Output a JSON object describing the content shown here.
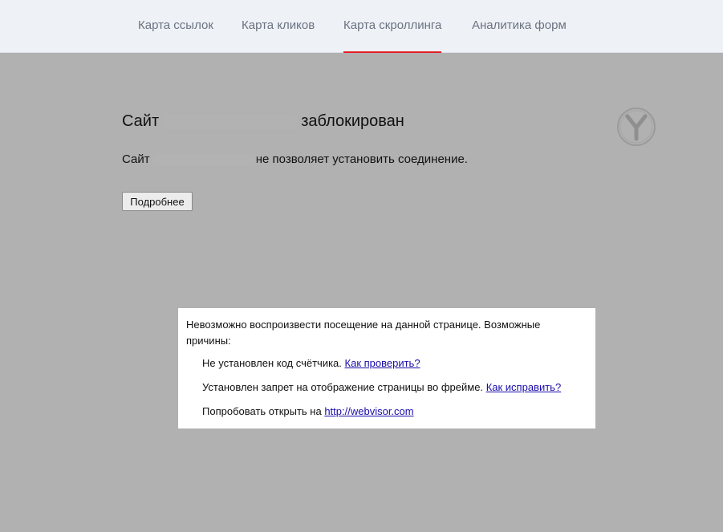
{
  "tabs": [
    {
      "label": "Карта ссылок",
      "active": false
    },
    {
      "label": "Карта кликов",
      "active": false
    },
    {
      "label": "Карта скроллинга",
      "active": true
    },
    {
      "label": "Аналитика форм",
      "active": false
    }
  ],
  "colors": {
    "active_tab_underline": "#e31e24",
    "page_background": "#b1b1b1",
    "nav_background": "#eef2f7"
  },
  "blocked_page": {
    "title_prefix": "Сайт",
    "title_suffix": "заблокирован",
    "desc_prefix": "Сайт",
    "desc_suffix": "не позволяет установить соединение.",
    "details_button": "Подробнее",
    "logo_icon": "yandex-browser-logo-icon"
  },
  "overlay": {
    "message": "Невозможно воспроизвести посещение на данной странице. Возможные причины:",
    "reasons": [
      {
        "text": "Не установлен код счётчика.",
        "link": "Как проверить?"
      },
      {
        "text": "Установлен запрет на отображение страницы во фрейме.",
        "link": "Как исправить?"
      },
      {
        "text": "Попробовать открыть на",
        "link": "http://webvisor.com"
      }
    ]
  }
}
